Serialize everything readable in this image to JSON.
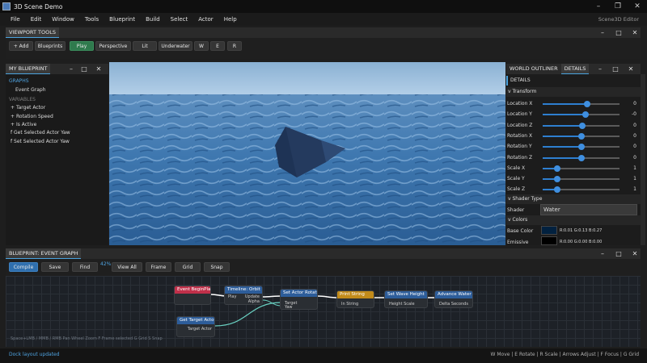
{
  "window": {
    "title": "3D Scene Demo",
    "brand": "Scene3D Editor"
  },
  "menu": [
    "File",
    "Edit",
    "Window",
    "Tools",
    "Blueprint",
    "Build",
    "Select",
    "Actor",
    "Help"
  ],
  "viewport_tools": {
    "title": "VIEWPORT TOOLS",
    "buttons": [
      "+ Add",
      "Blueprints",
      "Play",
      "Perspective",
      "Lit",
      "Underwater",
      "W",
      "E",
      "R"
    ]
  },
  "my_blueprint": {
    "title": "MY BLUEPRINT",
    "graphs_label": "GRAPHS",
    "event_graph": "Event Graph",
    "variables_label": "VARIABLES",
    "variables": [
      "Target Actor",
      "Rotation Speed",
      "Is Active"
    ],
    "functions": [
      "Get Selected Actor Yaw",
      "Set Selected Actor Yaw"
    ]
  },
  "right_panel": {
    "tabs": [
      "WORLD OUTLINER",
      "DETAILS"
    ],
    "details_header": "DETAILS",
    "transform_label": "Transform",
    "properties": [
      {
        "label": "Location X",
        "value": "0",
        "fraction": 0.58
      },
      {
        "label": "Location Y",
        "value": "-0",
        "fraction": 0.56
      },
      {
        "label": "Location Z",
        "value": "0",
        "fraction": 0.52
      },
      {
        "label": "Rotation X",
        "value": "0",
        "fraction": 0.5
      },
      {
        "label": "Rotation Y",
        "value": "0",
        "fraction": 0.5
      },
      {
        "label": "Rotation Z",
        "value": "0",
        "fraction": 0.5
      },
      {
        "label": "Scale X",
        "value": "1",
        "fraction": 0.19
      },
      {
        "label": "Scale Y",
        "value": "1",
        "fraction": 0.19
      },
      {
        "label": "Scale Z",
        "value": "1",
        "fraction": 0.19
      }
    ],
    "shader_type_label": "Shader Type",
    "shader_label": "Shader",
    "shader_value": "Water",
    "colors_label": "Colors",
    "base_color_label": "Base Color",
    "base_color_value": "R:0.01 G:0.13 B:0.27",
    "base_color_hex": "#02213f",
    "emissive_label": "Emissive",
    "emissive_value": "R:0.00 G:0.00 B:0.00",
    "emissive_hex": "#000000"
  },
  "event_graph": {
    "title": "BLUEPRINT: EVENT GRAPH",
    "buttons": [
      "Compile",
      "Save",
      "Find",
      "View All",
      "Frame",
      "Grid",
      "Snap"
    ],
    "zoom": "42%",
    "hint": "Space+LMB / MMB / RMB  Pan    Wheel  Zoom    F  Frame selected    G  Grid    S  Snap",
    "nodes": {
      "begin_play": {
        "title": "Event BeginPlay",
        "color": "#c0304a"
      },
      "timeline": {
        "title": "Timeline: Orbit",
        "color": "#2d5d9a",
        "pins": [
          "Play",
          "Update",
          "Alpha"
        ]
      },
      "set_rotation": {
        "title": "Set Actor Rotation",
        "color": "#2d5d9a",
        "pins": [
          "Target",
          "Yaw"
        ]
      },
      "print_string": {
        "title": "Print String",
        "color": "#c28b1a",
        "pins": [
          "In String"
        ]
      },
      "set_wave": {
        "title": "Set Wave Height",
        "color": "#2d5d9a",
        "pins": [
          "Height Scale"
        ]
      },
      "advance_water": {
        "title": "Advance Water Si",
        "color": "#2d5d9a",
        "pins": [
          "Delta Seconds"
        ]
      },
      "get_target": {
        "title": "Get Target Actor",
        "color": "#2d5d9a",
        "pins": [
          "Target Actor"
        ]
      }
    }
  },
  "status": {
    "left": "Dock layout updated",
    "right": "W Move | E Rotate | R Scale | Arrows Adjust | F Focus | G Grid"
  }
}
